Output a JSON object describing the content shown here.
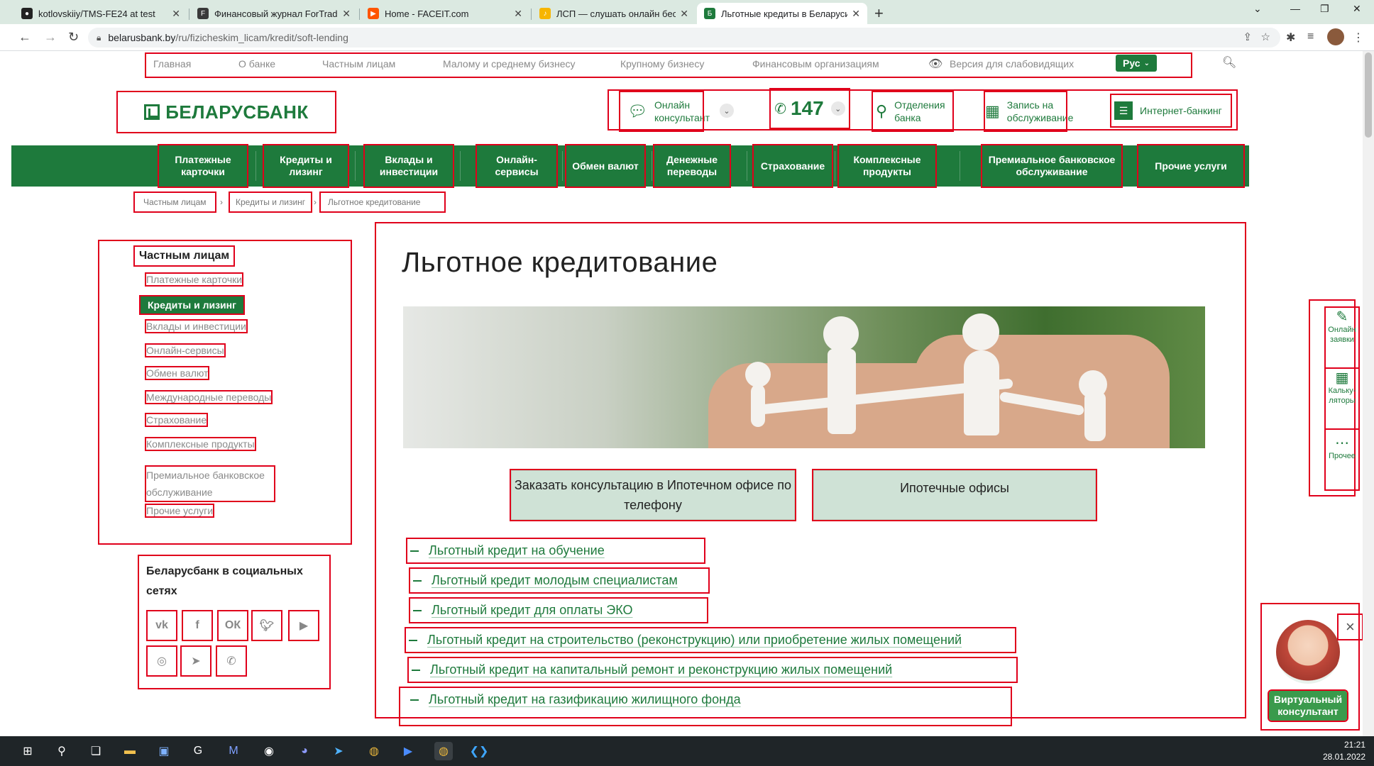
{
  "browser": {
    "tabs": [
      {
        "title": "kotlovskiiy/TMS-FE24 at test",
        "favicon": "github-icon"
      },
      {
        "title": "Финансовый журнал ForTrader.o",
        "favicon": "fortrader-icon"
      },
      {
        "title": "Home - FACEIT.com",
        "favicon": "faceit-icon"
      },
      {
        "title": "ЛСП — слушать онлайн беспла",
        "favicon": "music-icon"
      },
      {
        "title": "Льготные кредиты в Беларуси |",
        "favicon": "belarusbank-icon"
      }
    ],
    "new_tab": "+",
    "url_host": "belarusbank.by",
    "url_path": "/ru/fizicheskim_licam/kredit/soft-lending"
  },
  "toplinks": [
    "Главная",
    "О банке",
    "Частным лицам",
    "Малому и среднему бизнесу",
    "Крупному бизнесу",
    "Финансовым организациям",
    "Версия для слабовидящих"
  ],
  "lang": "Рус",
  "logo": "БЕЛАРУСБАНК",
  "header": {
    "consultant": "Онлайн консультант",
    "phone": "147",
    "branches": "Отделения банка",
    "appointment": "Запись на обслуживание",
    "internet_banking": "Интернет-банкинг"
  },
  "mainnav": [
    "Платежные карточки",
    "Кредиты и лизинг",
    "Вклады и инвестиции",
    "Онлайн-сервисы",
    "Обмен валют",
    "Денежные переводы",
    "Страхование",
    "Комплексные продукты",
    "Премиальное банковское обслуживание",
    "Прочие услуги"
  ],
  "breadcrumb": [
    "Частным лицам",
    "Кредиты и лизинг",
    "Льготное кредитование"
  ],
  "sidebar": {
    "title": "Частным лицам",
    "items": [
      "Платежные карточки",
      "Кредиты и лизинг",
      "Вклады и инвестиции",
      "Онлайн-сервисы",
      "Обмен валют",
      "Международные переводы",
      "Страхование",
      "Комплексные продукты",
      "Премиальное банковское обслуживание",
      "Прочие услуги"
    ],
    "active_index": 1
  },
  "social": {
    "title": "Беларусбанк в социальных сетях",
    "icons": [
      "vk-icon",
      "facebook-icon",
      "odnoklassniki-icon",
      "twitter-icon",
      "youtube-icon",
      "instagram-icon",
      "telegram-icon",
      "viber-icon"
    ]
  },
  "content": {
    "title": "Льготное кредитование",
    "cta_consult": "Заказать консультацию в Ипотечном офисе по телефону",
    "cta_offices": "Ипотечные офисы",
    "loans": [
      "Льготный кредит на обучение",
      "Льготный кредит молодым специалистам",
      "Льготный кредит для оплаты ЭКО",
      "Льготный кредит на строительство (реконструкцию) или приобретение жилых помещений",
      "Льготный кредит на капитальный ремонт и реконструкцию жилых помещений",
      "Льготный кредит на газификацию жилищного фонда"
    ]
  },
  "floating_panel": {
    "online_requests": "Онлайн заявки",
    "calculators": "Кальку- ляторы",
    "other": "Прочее"
  },
  "virtual_consultant": {
    "button": "Виртуальный консультант",
    "close": "×"
  },
  "taskbar": {
    "time": "21:21",
    "date": "28.01.2022"
  },
  "colors": {
    "brand_green": "#1e7a3c",
    "annotation_red": "#e0001b"
  }
}
